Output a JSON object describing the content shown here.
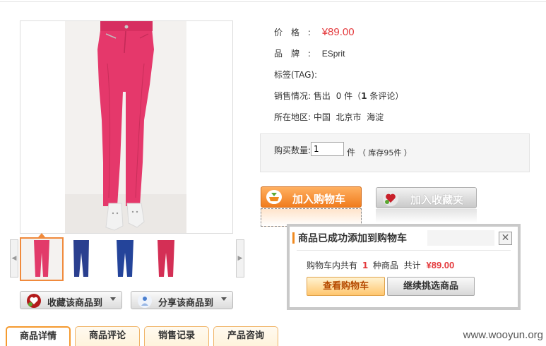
{
  "product": {
    "price_label": "价　格",
    "price": "¥89.00",
    "brand_label": "品　牌",
    "brand": "ESprit",
    "tag_label": "标签(TAG):",
    "sales_label": "销售情况:",
    "sales_text_prefix": "售出",
    "sales_count": "0 件",
    "review_prefix": "（",
    "review_count": "1",
    "review_suffix": "条评论）",
    "location_label": "所在地区:",
    "location": "中国  北京市  海淀",
    "colon": ":"
  },
  "quantity": {
    "label": "购买数量:",
    "value": "1",
    "unit": "件",
    "stock": "（ 库存95件 ）"
  },
  "buttons": {
    "add_to_cart": "加入购物车",
    "add_to_favorites": "加入收藏夹",
    "collect_to": "收藏该商品到",
    "share_to": "分享该商品到"
  },
  "tabs": [
    {
      "label": "商品详情"
    },
    {
      "label": "商品评论"
    },
    {
      "label": "销售记录"
    },
    {
      "label": "产品咨询"
    }
  ],
  "popup": {
    "title": "商品已成功添加到购物车",
    "close": "✕",
    "msg_prefix": "购物车内共有",
    "item_count": "1",
    "msg_mid": "种商品  共计",
    "total": "¥89.00",
    "view_cart": "查看购物车",
    "continue_shopping": "继续挑选商品"
  },
  "thumbnails": [
    {
      "color": "#e23a6a",
      "selected": true
    },
    {
      "color": "#2a3f8f",
      "selected": false
    },
    {
      "color": "#24449a",
      "selected": false
    },
    {
      "color": "#d42f55",
      "selected": false
    }
  ],
  "icons": {
    "thumb_prev": "◀",
    "thumb_next": "▶"
  },
  "colors": {
    "price": "#e4393c",
    "accent_orange": "#f08a20",
    "pants_pink": "#e23a6a"
  },
  "watermark": "www.wooyun.org"
}
